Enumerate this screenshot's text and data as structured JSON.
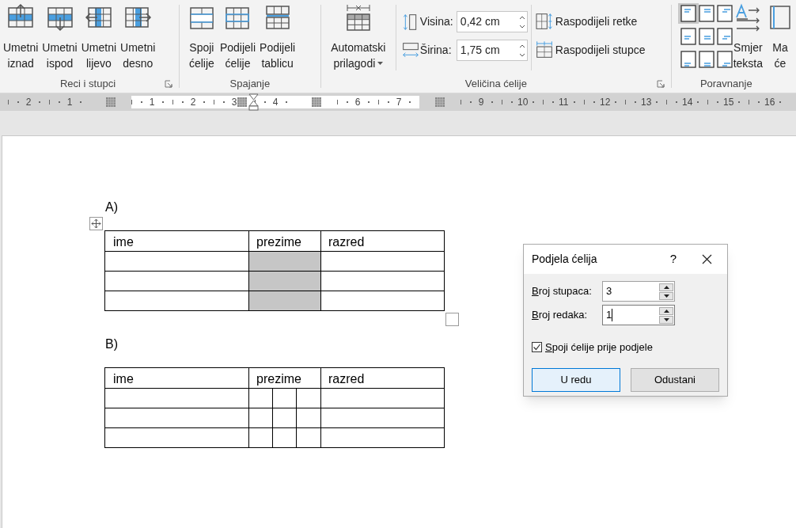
{
  "ribbon": {
    "groups": [
      {
        "label": "Reci i stupci",
        "launcher": true,
        "buttons": [
          {
            "lines": [
              "Umetni",
              "iznad"
            ]
          },
          {
            "lines": [
              "Umetni",
              "ispod"
            ]
          },
          {
            "lines": [
              "Umetni",
              "lijevo"
            ]
          },
          {
            "lines": [
              "Umetni",
              "desno"
            ]
          }
        ]
      },
      {
        "label": "Spajanje",
        "launcher": false,
        "buttons": [
          {
            "lines": [
              "Spoji",
              "ćelije"
            ]
          },
          {
            "lines": [
              "Podijeli",
              "ćelije"
            ]
          },
          {
            "lines": [
              "Podijeli",
              "tablicu"
            ]
          }
        ]
      },
      {
        "label": "Veličina ćelije",
        "launcher": true,
        "autofit": {
          "lines": [
            "Automatski",
            "prilagodi"
          ]
        },
        "fields": [
          {
            "label": "Visina:",
            "value": "0,42 cm"
          },
          {
            "label": "Širina:",
            "value": "1,75 cm"
          }
        ],
        "distribute": [
          "Raspodijeli retke",
          "Raspodijeli stupce"
        ]
      },
      {
        "label": "Poravnanje",
        "launcher": false,
        "align": [
          {
            "selected": true
          },
          {
            "selected": false
          },
          {
            "selected": false
          },
          {
            "selected": false
          },
          {
            "selected": false
          },
          {
            "selected": false
          },
          {
            "selected": false
          },
          {
            "selected": false
          },
          {
            "selected": false
          }
        ],
        "buttons": [
          {
            "lines": [
              "Smjer",
              "teksta"
            ]
          },
          {
            "lines": [
              "Ma",
              "će"
            ]
          }
        ]
      }
    ]
  },
  "ruler": [
    {
      "kind": "number",
      "text": "2",
      "margin": true
    },
    {
      "kind": "number",
      "text": "1",
      "margin": true
    },
    {
      "kind": "marker",
      "margin": true
    },
    {
      "kind": "number",
      "text": "1",
      "margin": false
    },
    {
      "kind": "number",
      "text": "2",
      "margin": false
    },
    {
      "kind": "number",
      "text": "3",
      "margin": false
    },
    {
      "kind": "number",
      "text": "4",
      "margin": false
    },
    {
      "kind": "marker",
      "margin": false
    },
    {
      "kind": "number",
      "text": "6",
      "margin": false
    },
    {
      "kind": "number",
      "text": "7",
      "margin": false
    },
    {
      "kind": "marker",
      "margin": true
    },
    {
      "kind": "number",
      "text": "9",
      "margin": true
    },
    {
      "kind": "number",
      "text": "10",
      "margin": true
    },
    {
      "kind": "number",
      "text": "11",
      "margin": true
    },
    {
      "kind": "number",
      "text": "12",
      "margin": true
    },
    {
      "kind": "number",
      "text": "13",
      "margin": true
    },
    {
      "kind": "number",
      "text": "14",
      "margin": true
    },
    {
      "kind": "number",
      "text": "15",
      "margin": true
    },
    {
      "kind": "number",
      "text": "16",
      "margin": true
    }
  ],
  "document": {
    "tables": [
      {
        "label": "A)",
        "columns": [
          "ime",
          "prezime",
          "razred"
        ],
        "rows": [
          {
            "cells": [
              {
                "kind": "plain",
                "selected": false
              },
              {
                "kind": "plain",
                "selected": true
              },
              {
                "kind": "plain",
                "selected": false
              }
            ]
          },
          {
            "cells": [
              {
                "kind": "plain",
                "selected": false
              },
              {
                "kind": "plain",
                "selected": true
              },
              {
                "kind": "plain",
                "selected": false
              }
            ]
          },
          {
            "cells": [
              {
                "kind": "plain",
                "selected": false
              },
              {
                "kind": "plain",
                "selected": true
              },
              {
                "kind": "plain",
                "selected": false
              }
            ]
          }
        ]
      },
      {
        "label": "B)",
        "columns": [
          "ime",
          "prezime",
          "razred"
        ],
        "rows": [
          {
            "cells": [
              {
                "kind": "plain",
                "selected": false
              },
              {
                "kind": "split",
                "selected": false
              },
              {
                "kind": "plain",
                "selected": false
              }
            ]
          },
          {
            "cells": [
              {
                "kind": "plain",
                "selected": false
              },
              {
                "kind": "split",
                "selected": false
              },
              {
                "kind": "plain",
                "selected": false
              }
            ]
          },
          {
            "cells": [
              {
                "kind": "plain",
                "selected": false
              },
              {
                "kind": "split",
                "selected": false
              },
              {
                "kind": "plain",
                "selected": false
              }
            ]
          }
        ]
      }
    ]
  },
  "dialog": {
    "title": "Podjela ćelija",
    "help": "?",
    "fields": [
      {
        "label": "Broj stupaca:",
        "value": "3",
        "focused": false
      },
      {
        "label": "Broj redaka:",
        "value": "1",
        "focused": true
      }
    ],
    "checkbox": {
      "label": "Spoji ćelije prije podjele",
      "checked": true
    },
    "buttons": [
      {
        "label": "U redu",
        "default": true
      },
      {
        "label": "Odustani",
        "default": false
      }
    ]
  }
}
